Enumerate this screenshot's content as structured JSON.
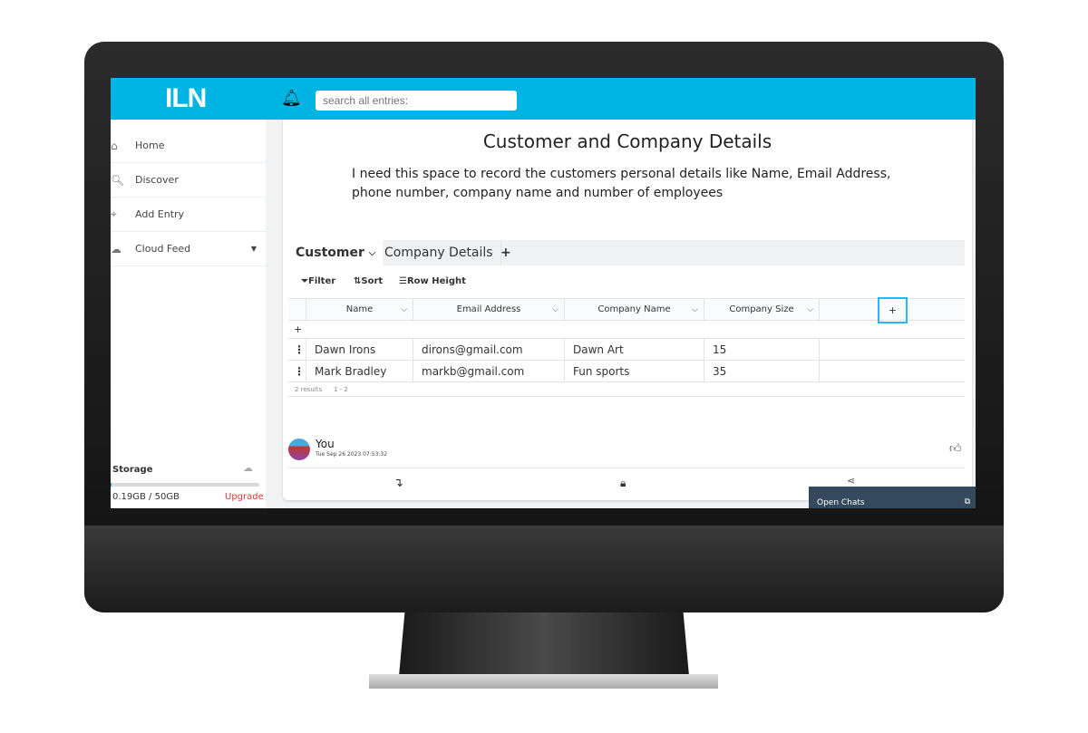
{
  "header": {
    "logo": "ILN",
    "search_placeholder": "search all entries:"
  },
  "sidebar": {
    "items": [
      {
        "label": "Home",
        "icon": "home-icon"
      },
      {
        "label": "Discover",
        "icon": "search-icon"
      },
      {
        "label": "Add Entry",
        "icon": "crosshair-icon"
      },
      {
        "label": "Cloud Feed",
        "icon": "cloud-icon"
      }
    ],
    "storage": {
      "label": "Storage",
      "used": "0.19GB / 50GB",
      "upgrade": "Upgrade",
      "fraction": 0.0038
    }
  },
  "entry": {
    "title": "Customer and Company Details",
    "description": "I need this space to record the customers personal details like Name, Email Address, phone number, company name and number of employees",
    "tabs": [
      "Customer",
      "Company Details"
    ],
    "add_tab": "+",
    "toolbar": {
      "filter": "Filter",
      "sort": "Sort",
      "row_height": "Row Height"
    },
    "columns": [
      "Name",
      "Email Address",
      "Company Name",
      "Company Size"
    ],
    "add_column": "+",
    "add_row": "+",
    "rows": [
      [
        "Dawn Irons",
        "dirons@gmail.com",
        "Dawn Art",
        "15"
      ],
      [
        "Mark Bradley",
        "markb@gmail.com",
        "Fun sports",
        "35"
      ]
    ],
    "results": "2 results",
    "range": "1 - 2",
    "author": "You",
    "date": "Tue Sep 26 2023 07:53:32"
  },
  "chats": {
    "label": "Open Chats"
  },
  "colors": {
    "header": "#00b4e4",
    "chats": "#34495e",
    "upgrade": "#e53935"
  }
}
